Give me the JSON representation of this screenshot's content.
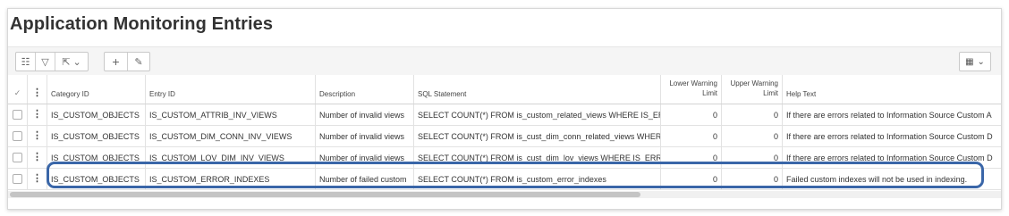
{
  "page": {
    "title": "Application Monitoring Entries"
  },
  "toolbar": {
    "left_buttons": [
      {
        "icon": "list-icon",
        "glyph": "☷"
      },
      {
        "icon": "filter-icon",
        "glyph": "▽"
      },
      {
        "icon": "export-icon",
        "glyph": "⇱ ⌄"
      },
      {
        "icon": "add-icon",
        "glyph": "+"
      },
      {
        "icon": "edit-icon",
        "glyph": "✎"
      }
    ],
    "right_button": {
      "icon": "table-settings-icon",
      "glyph": "▦",
      "chevron": "⌄"
    }
  },
  "table": {
    "headers": {
      "check": "✓",
      "menu": "⋮",
      "category_id": "Category ID",
      "entry_id": "Entry ID",
      "description": "Description",
      "sql": "SQL Statement",
      "lower": "Lower Warning Limit",
      "upper": "Upper Warning Limit",
      "help": "Help Text"
    },
    "rows": [
      {
        "category_id": "IS_CUSTOM_OBJECTS",
        "entry_id": "IS_CUSTOM_ATTRIB_INV_VIEWS",
        "description": "Number of invalid views",
        "sql": "SELECT COUNT(*) FROM is_custom_related_views WHERE IS_ERRO",
        "lower": "0",
        "upper": "0",
        "help": "If there are errors related to Information Source Custom A"
      },
      {
        "category_id": "IS_CUSTOM_OBJECTS",
        "entry_id": "IS_CUSTOM_DIM_CONN_INV_VIEWS",
        "description": "Number of invalid views",
        "sql": "SELECT COUNT(*) FROM is_cust_dim_conn_related_views WHERE",
        "lower": "0",
        "upper": "0",
        "help": "If there are errors related to Information Source Custom D"
      },
      {
        "category_id": "IS_CUSTOM_OBJECTS",
        "entry_id": "IS_CUSTOM_LOV_DIM_INV_VIEWS",
        "description": "Number of invalid views",
        "sql": "SELECT COUNT(*) FROM is_cust_dim_lov_views WHERE IS_ERROR",
        "lower": "0",
        "upper": "0",
        "help": "If there are errors related to Information Source Custom D"
      },
      {
        "category_id": "IS_CUSTOM_OBJECTS",
        "entry_id": "IS_CUSTOM_ERROR_INDEXES",
        "description": "Number of failed custom",
        "sql": "SELECT COUNT(*) FROM is_custom_error_indexes",
        "lower": "0",
        "upper": "0",
        "help": "Failed custom indexes will not be used in indexing."
      }
    ]
  },
  "colors": {
    "highlight": "#3a66a8",
    "toolbar_bg": "#f5f5f5",
    "row_border": "#e2e2e2"
  }
}
